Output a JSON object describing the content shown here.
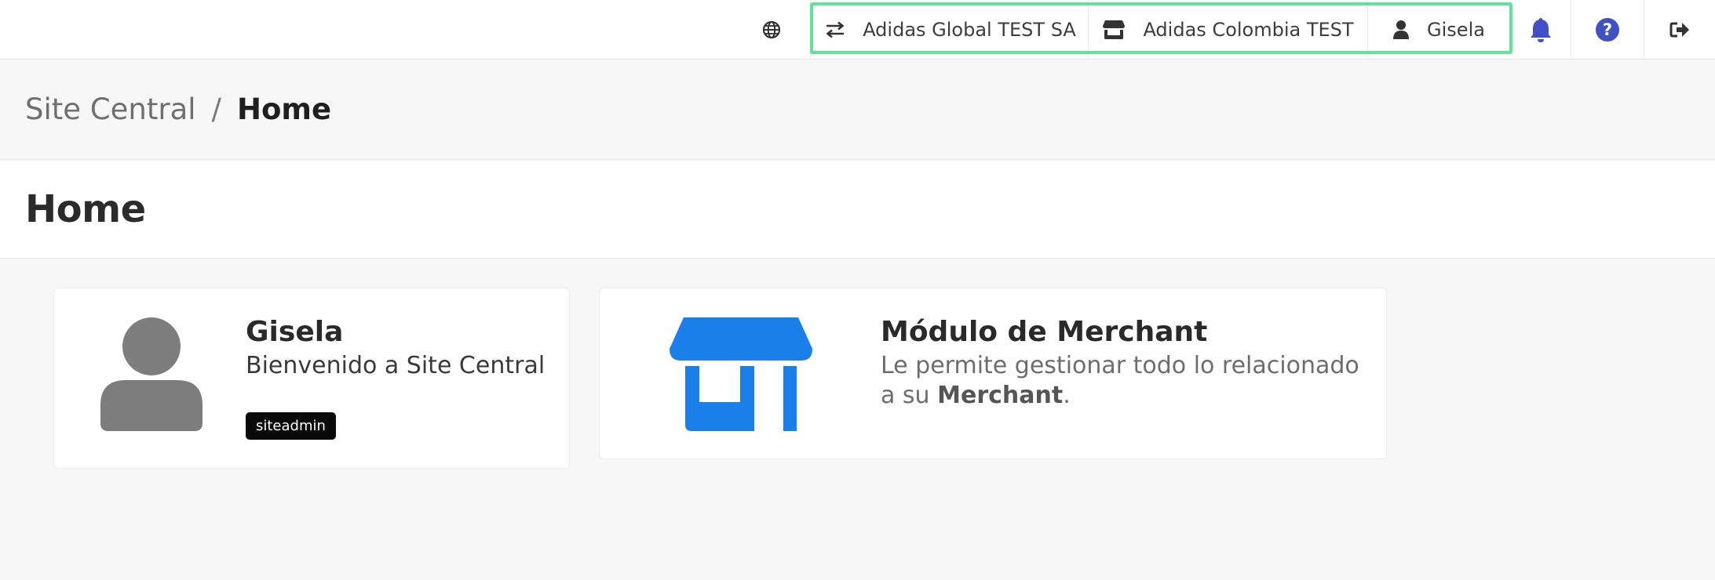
{
  "topbar": {
    "language_icon": "globe-icon",
    "company": {
      "icon": "swap-arrows-icon",
      "label": "Adidas Global TEST SA"
    },
    "merchant": {
      "icon": "store-icon",
      "label": "Adidas Colombia TEST"
    },
    "user": {
      "icon": "user-icon",
      "label": "Gisela"
    },
    "notifications_icon": "bell-icon",
    "help_icon": "question-circle-icon",
    "logout_icon": "sign-out-icon",
    "accent_color": "#3f51c5",
    "highlight_color": "#5de39a"
  },
  "breadcrumb": {
    "root": "Site Central",
    "separator": "/",
    "current": "Home"
  },
  "page": {
    "title": "Home"
  },
  "user_card": {
    "name": "Gisela",
    "welcome": "Bienvenido a Site Central",
    "role_badge": "siteadmin",
    "avatar_icon": "user-avatar-icon"
  },
  "merchant_card": {
    "title": "Módulo de Merchant",
    "description": "Le permite gestionar todo lo relacionado a su",
    "description_bold": "Merchant",
    "description_end": ".",
    "icon": "store-icon",
    "icon_color": "#1a7fe8"
  }
}
